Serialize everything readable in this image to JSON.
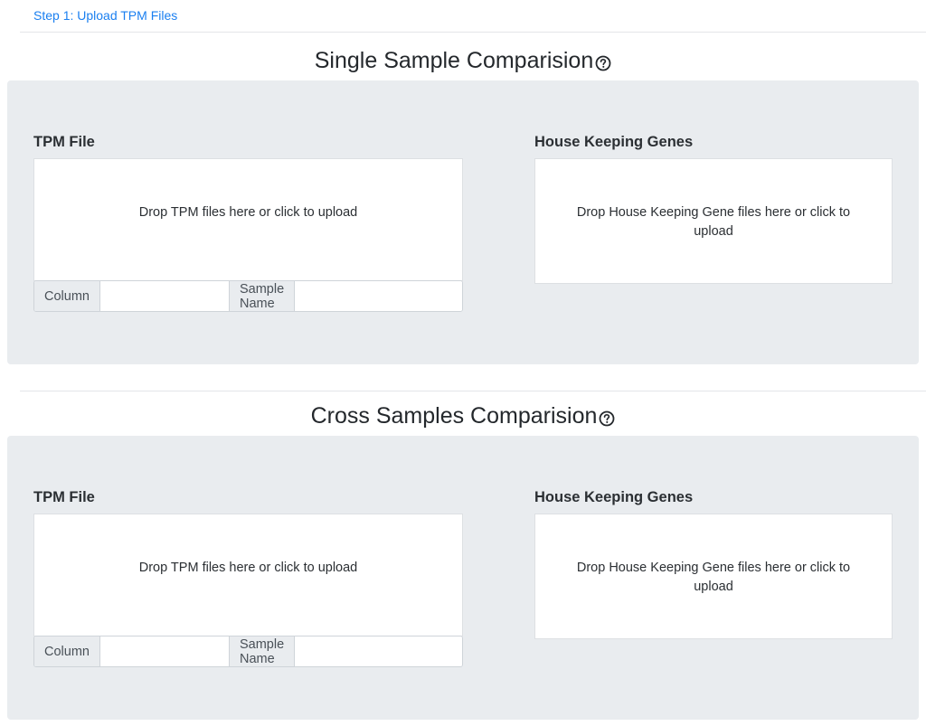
{
  "step_link": "Step 1: Upload TPM Files",
  "sections": [
    {
      "title": "Single Sample Comparision",
      "tpm": {
        "label": "TPM File",
        "dropzone": "Drop TPM files here or click to upload",
        "column_label": "Column",
        "column_value": "",
        "sample_name_label": "Sample Name",
        "sample_name_value": ""
      },
      "hk": {
        "label": "House Keeping Genes",
        "dropzone": "Drop House Keeping Gene files here or click to upload"
      }
    },
    {
      "title": "Cross Samples Comparision",
      "tpm": {
        "label": "TPM File",
        "dropzone": "Drop TPM files here or click to upload",
        "column_label": "Column",
        "column_value": "",
        "sample_name_label": "Sample Name",
        "sample_name_value": ""
      },
      "hk": {
        "label": "House Keeping Genes",
        "dropzone": "Drop House Keeping Gene files here or click to upload"
      }
    }
  ],
  "icons": {
    "help": "question-circle-icon"
  },
  "colors": {
    "link": "#1a7ff0",
    "panel_bg": "#e9ecef",
    "addon_bg": "#e9ecef"
  }
}
